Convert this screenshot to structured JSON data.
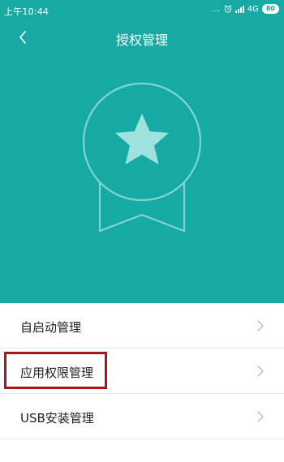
{
  "status_bar": {
    "time": "上午10:44",
    "dots": "...",
    "alarm_icon": "alarm-clock-icon",
    "network": "4G",
    "battery": "80"
  },
  "header": {
    "title": "授权管理",
    "back_icon": "chevron-left-icon"
  },
  "hero": {
    "background_color": "#17aaa5",
    "badge_icon": "star-ribbon-badge-icon"
  },
  "list": {
    "items": [
      {
        "label": "自启动管理"
      },
      {
        "label": "应用权限管理"
      },
      {
        "label": "USB安装管理"
      }
    ],
    "chevron_icon": "chevron-right-icon"
  },
  "annotation": {
    "highlight_color": "#b0121b"
  }
}
